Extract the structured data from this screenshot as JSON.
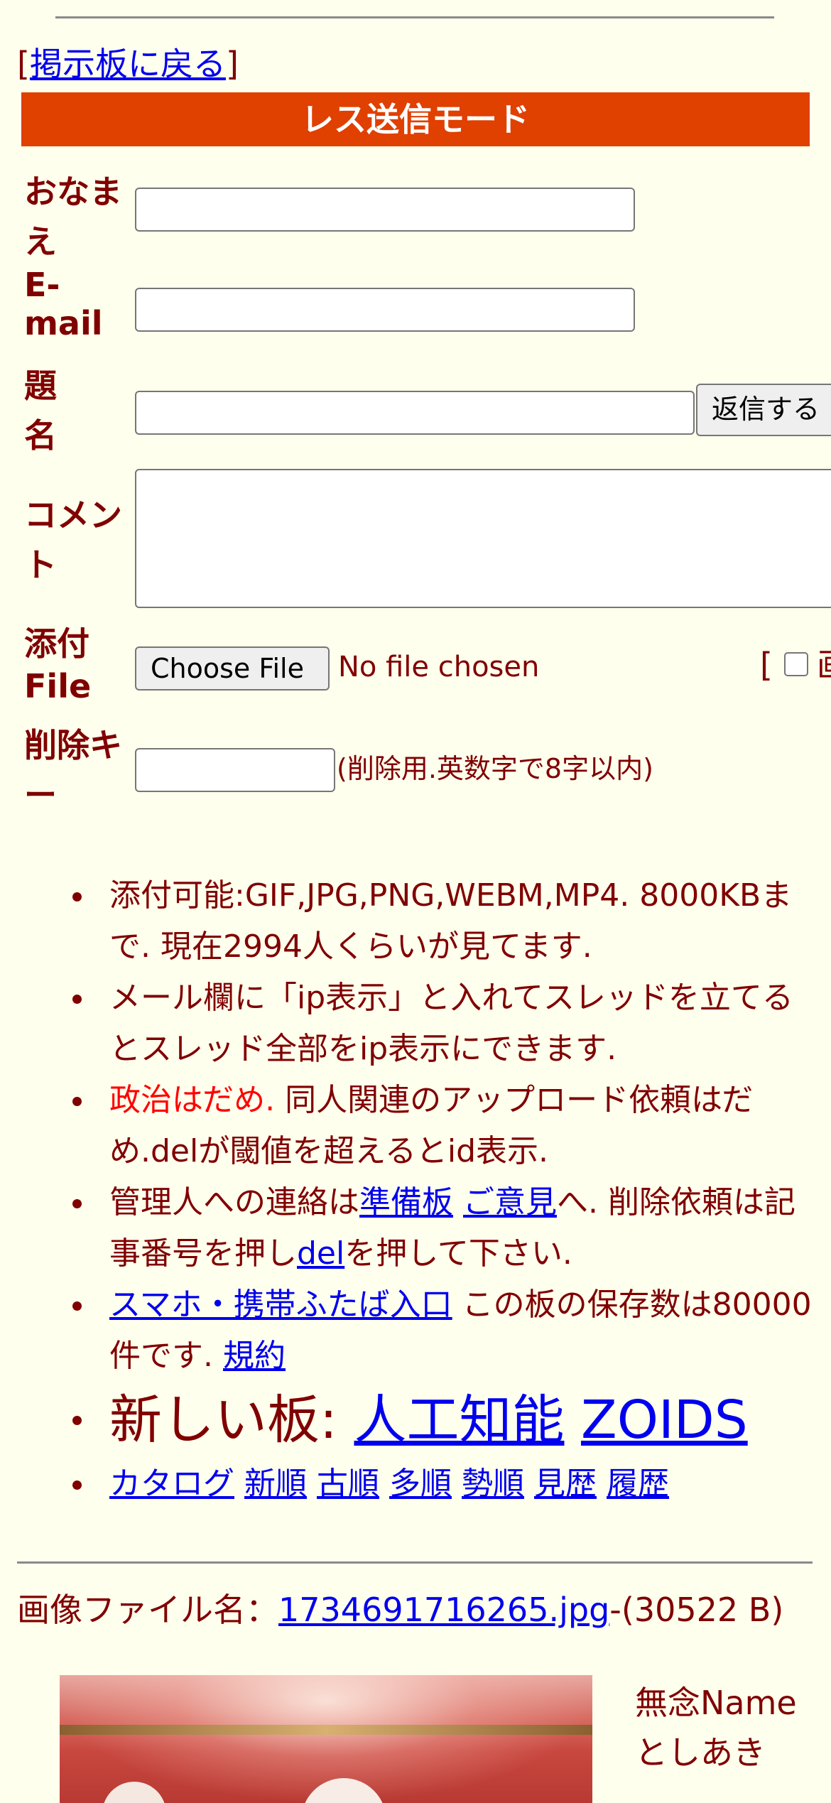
{
  "nav": {
    "back_open": "[",
    "back_link": "掲示板に戻る",
    "back_close": "]"
  },
  "form": {
    "mode_title": "レス送信モード",
    "labels": {
      "name": "おなまえ",
      "email": "E-mail",
      "subject": "題名",
      "comment": "コメント",
      "attach": "添付File",
      "delete_key": "削除キー"
    },
    "submit_label": "返信する",
    "choose_file_label": "Choose File",
    "file_status": "No file chosen",
    "img_only_bracket": "[",
    "img_only_clipped": "画",
    "delete_key_note": "(削除用.英数字で8字以内)"
  },
  "rules": {
    "r1": "添付可能:GIF,JPG,PNG,WEBM,MP4. 8000KBまで. 現在2994人くらいが見てます.",
    "r2": "メール欄に「ip表示」と入れてスレッドを立てるとスレッド全部をip表示にできます.",
    "r3_red": "政治はだめ.",
    "r3_rest": " 同人関連のアップロード依頼はだめ.delが閾値を超えるとid表示.",
    "r4_a": "管理人への連絡は",
    "r4_link1": "準備板",
    "r4_link2": "ご意見",
    "r4_b": "へ. 削除依頼は記事番号を押し",
    "r4_link3": "del",
    "r4_c": "を押して下さい.",
    "r5_link1": "スマホ・携帯ふたば入口",
    "r5_a": " この板の保存数は80000件です. ",
    "r5_link2": "規約",
    "r6_prefix": "新しい板: ",
    "r6_link1": "人工知能",
    "r6_link2": "ZOIDS",
    "r7_links": [
      "カタログ",
      "新順",
      "古順",
      "多順",
      "勢順",
      "見歴",
      "履歴"
    ]
  },
  "post": {
    "file_label": "画像ファイル名：",
    "file_name": "1734691716265.jpg",
    "file_size": "-(30522 B)",
    "poster_line1": "無念Name",
    "poster_line2": "としあき"
  },
  "colors": {
    "background": "#ffffee",
    "text": "#800000",
    "mode_bar": "#e04000",
    "link": "#0000ee",
    "warning": "#ff0000"
  }
}
